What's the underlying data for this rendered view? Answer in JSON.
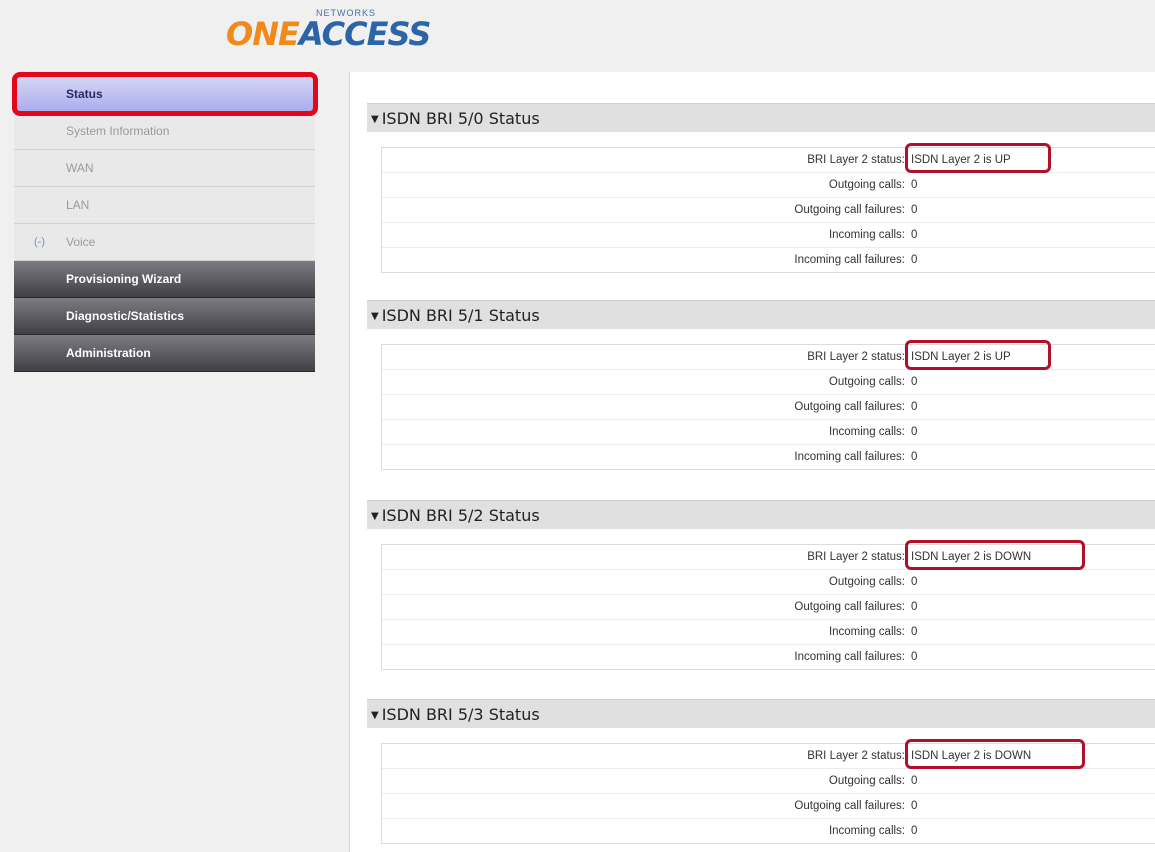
{
  "logo": {
    "one": "ONE",
    "access": "ACCESS",
    "networks": "NETWORKS"
  },
  "sidebar": {
    "items": [
      {
        "label": "Status",
        "toggle": ""
      },
      {
        "label": "System Information",
        "toggle": ""
      },
      {
        "label": "WAN",
        "toggle": ""
      },
      {
        "label": "LAN",
        "toggle": ""
      },
      {
        "label": "Voice",
        "toggle": "(-)"
      },
      {
        "label": "Provisioning Wizard",
        "toggle": ""
      },
      {
        "label": "Diagnostic/Statistics",
        "toggle": ""
      },
      {
        "label": "Administration",
        "toggle": ""
      }
    ]
  },
  "sections": [
    {
      "title": "ISDN BRI 5/0 Status",
      "rows": [
        {
          "label": "BRI Layer 2 status:",
          "value": "ISDN Layer 2 is UP"
        },
        {
          "label": "Outgoing calls:",
          "value": "0"
        },
        {
          "label": "Outgoing call failures:",
          "value": "0"
        },
        {
          "label": "Incoming calls:",
          "value": "0"
        },
        {
          "label": "Incoming call failures:",
          "value": "0"
        }
      ]
    },
    {
      "title": "ISDN BRI 5/1 Status",
      "rows": [
        {
          "label": "BRI Layer 2 status:",
          "value": "ISDN Layer 2 is UP"
        },
        {
          "label": "Outgoing calls:",
          "value": "0"
        },
        {
          "label": "Outgoing call failures:",
          "value": "0"
        },
        {
          "label": "Incoming calls:",
          "value": "0"
        },
        {
          "label": "Incoming call failures:",
          "value": "0"
        }
      ]
    },
    {
      "title": "ISDN BRI 5/2 Status",
      "rows": [
        {
          "label": "BRI Layer 2 status:",
          "value": "ISDN Layer 2 is DOWN"
        },
        {
          "label": "Outgoing calls:",
          "value": "0"
        },
        {
          "label": "Outgoing call failures:",
          "value": "0"
        },
        {
          "label": "Incoming calls:",
          "value": "0"
        },
        {
          "label": "Incoming call failures:",
          "value": "0"
        }
      ]
    },
    {
      "title": "ISDN BRI 5/3 Status",
      "rows": [
        {
          "label": "BRI Layer 2 status:",
          "value": "ISDN Layer 2 is DOWN"
        },
        {
          "label": "Outgoing calls:",
          "value": "0"
        },
        {
          "label": "Outgoing call failures:",
          "value": "0"
        },
        {
          "label": "Incoming calls:",
          "value": "0"
        }
      ]
    }
  ],
  "colors": {
    "highlight": "#e3071b",
    "value_box": "#b01028",
    "logo_orange": "#f28a1b",
    "logo_blue": "#2c64a8"
  }
}
